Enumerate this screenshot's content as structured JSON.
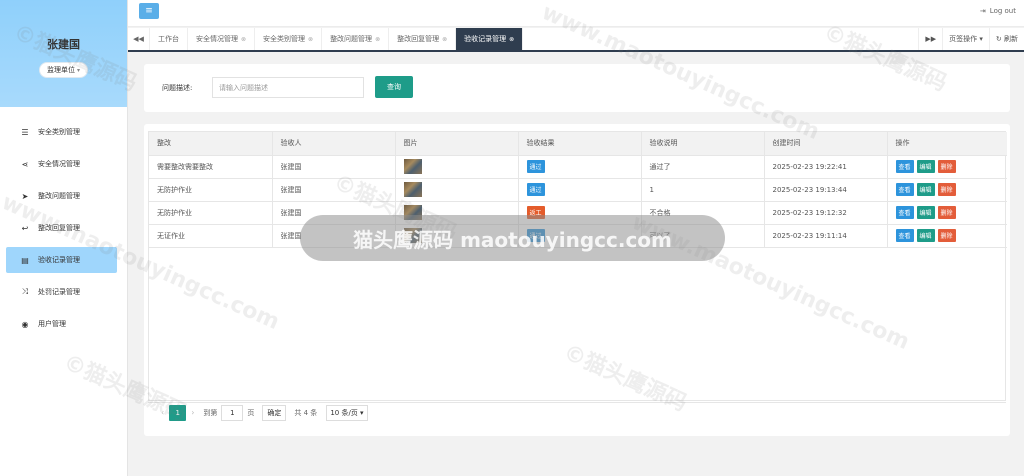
{
  "user": {
    "name": "张建国",
    "role": "监理单位"
  },
  "sidebar": {
    "items": [
      {
        "icon": "sliders-icon",
        "glyph": "☰",
        "label": "安全类别管理",
        "active": false
      },
      {
        "icon": "share-icon",
        "glyph": "⋖",
        "label": "安全情况管理",
        "active": false
      },
      {
        "icon": "send-icon",
        "glyph": "➤",
        "label": "整改问题管理",
        "active": false
      },
      {
        "icon": "reply-icon",
        "glyph": "↩",
        "label": "整改回复管理",
        "active": false
      },
      {
        "icon": "list-icon",
        "glyph": "▤",
        "label": "验收记录管理",
        "active": true
      },
      {
        "icon": "shuffle-icon",
        "glyph": "⤨",
        "label": "处罚记录管理",
        "active": false
      },
      {
        "icon": "user-circle-icon",
        "glyph": "◉",
        "label": "用户管理",
        "active": false
      }
    ]
  },
  "header": {
    "menu_glyph": "≡",
    "logout_label": "Log out"
  },
  "tabs": {
    "items": [
      {
        "label": "工作台",
        "closable": false
      },
      {
        "label": "安全情况管理",
        "closable": true
      },
      {
        "label": "安全类别管理",
        "closable": true
      },
      {
        "label": "整改问题管理",
        "closable": true
      },
      {
        "label": "整改回复管理",
        "closable": true
      },
      {
        "label": "验收记录管理",
        "closable": true,
        "active": true
      }
    ],
    "page_ops_label": "页签操作",
    "refresh_label": "刷新"
  },
  "search": {
    "label": "问题描述:",
    "placeholder": "请输入问题描述",
    "button_label": "查询"
  },
  "table": {
    "columns": [
      "整改",
      "验收人",
      "图片",
      "验收结果",
      "验收说明",
      "创建时间",
      "操作"
    ],
    "rows": [
      {
        "rectification": "需要整改需要整改",
        "acceptor": "张建国",
        "result": "通过",
        "result_type": "pass",
        "note": "通过了",
        "created": "2025-02-23 19:22:41"
      },
      {
        "rectification": "无防护作业",
        "acceptor": "张建国",
        "result": "通过",
        "result_type": "pass",
        "note": "1",
        "created": "2025-02-23 19:13:44"
      },
      {
        "rectification": "无防护作业",
        "acceptor": "张建国",
        "result": "返工",
        "result_type": "rework",
        "note": "不合格",
        "created": "2025-02-23 19:12:32"
      },
      {
        "rectification": "无证作业",
        "acceptor": "张建国",
        "result": "通过",
        "result_type": "pass",
        "note": "可以了",
        "created": "2025-02-23 19:11:14"
      }
    ],
    "actions": {
      "view": "查看",
      "edit": "编辑",
      "delete": "删除"
    }
  },
  "pagination": {
    "current_page": "1",
    "goto_label": "到第",
    "page_input_value": "1",
    "page_unit": "页",
    "confirm_label": "确定",
    "total_label": "共 4 条",
    "page_size_label": "10 条/页"
  },
  "watermark": {
    "text": "©猫头鹰源码",
    "url": "www.maotouyingcc.com",
    "overlay_text": "猫头鹰源码 maotouyingcc.com"
  }
}
